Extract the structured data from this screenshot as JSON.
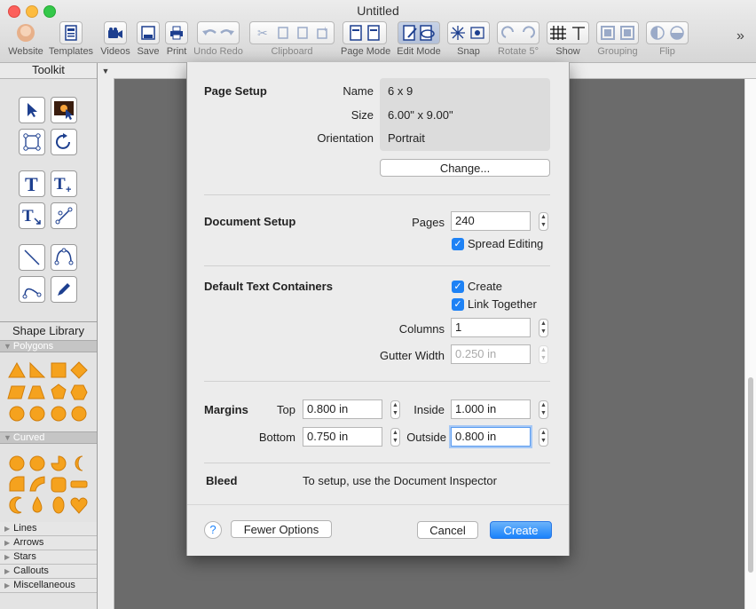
{
  "window": {
    "title": "Untitled"
  },
  "toolbar": {
    "items": [
      {
        "label": "Website"
      },
      {
        "label": "Templates"
      },
      {
        "label": "Videos"
      },
      {
        "label": "Save"
      },
      {
        "label": "Print"
      },
      {
        "label": "Undo Redo"
      },
      {
        "label": "Clipboard"
      },
      {
        "label": "Page Mode"
      },
      {
        "label": "Edit Mode"
      },
      {
        "label": "Snap"
      },
      {
        "label": "Rotate 5°"
      },
      {
        "label": "Show"
      },
      {
        "label": "Grouping"
      },
      {
        "label": "Flip"
      }
    ],
    "overflow": "»"
  },
  "toolkit": {
    "title": "Toolkit",
    "shape_library_title": "Shape Library",
    "sections": {
      "polygons": "Polygons",
      "curved": "Curved",
      "collapsed": [
        "Lines",
        "Arrows",
        "Stars",
        "Callouts",
        "Miscellaneous"
      ]
    }
  },
  "dialog": {
    "page_setup": {
      "heading": "Page Setup",
      "name_label": "Name",
      "name_value": "6 x 9",
      "size_label": "Size",
      "size_value": "6.00\" x 9.00\"",
      "orientation_label": "Orientation",
      "orientation_value": "Portrait",
      "change_button": "Change..."
    },
    "document_setup": {
      "heading": "Document Setup",
      "pages_label": "Pages",
      "pages_value": "240",
      "spread_editing": "Spread Editing"
    },
    "text_containers": {
      "heading": "Default Text Containers",
      "create": "Create",
      "link_together": "Link Together",
      "columns_label": "Columns",
      "columns_value": "1",
      "gutter_label": "Gutter Width",
      "gutter_value": "0.250 in"
    },
    "margins": {
      "heading": "Margins",
      "top_label": "Top",
      "top_value": "0.800 in",
      "bottom_label": "Bottom",
      "bottom_value": "0.750 in",
      "inside_label": "Inside",
      "inside_value": "1.000 in",
      "outside_label": "Outside",
      "outside_value": "0.800 in"
    },
    "bleed": {
      "heading": "Bleed",
      "text": "To setup, use the Document Inspector"
    },
    "footer": {
      "help": "?",
      "fewer_options": "Fewer Options",
      "cancel": "Cancel",
      "create": "Create"
    }
  },
  "colors": {
    "accent": "#1a82fb",
    "shape_orange": "#f5a21e"
  }
}
